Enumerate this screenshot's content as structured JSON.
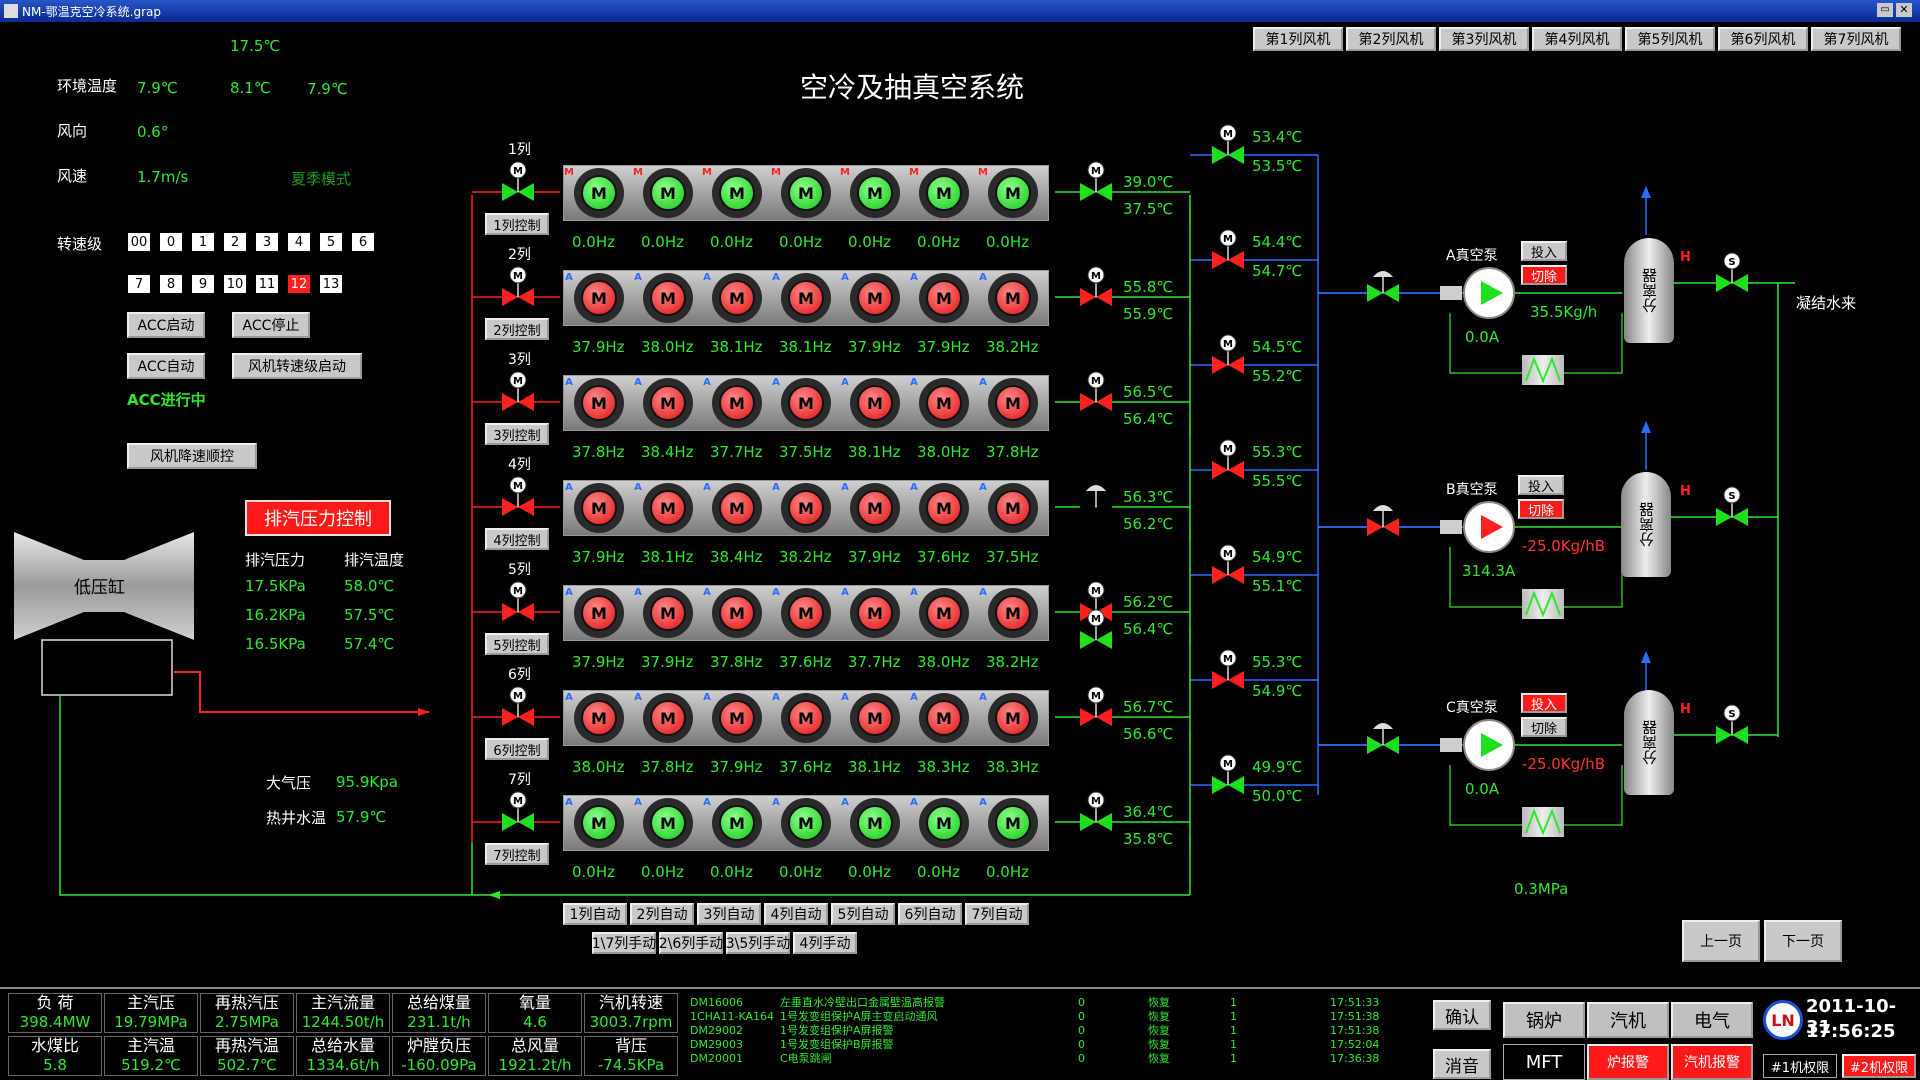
{
  "window": {
    "title": "NM-鄂温克空冷系统.grap"
  },
  "header": {
    "title": "空冷及抽真空系统"
  },
  "fan_tabs": [
    "第1列风机",
    "第2列风机",
    "第3列风机",
    "第4列风机",
    "第5列风机",
    "第6列风机",
    "第7列风机"
  ],
  "env": {
    "top_temp": "17.5℃",
    "env_label": "环境温度",
    "temps": [
      "7.9℃",
      "8.1℃",
      "7.9℃"
    ],
    "wind_dir_label": "风向",
    "wind_dir": "0.6°",
    "wind_speed_label": "风速",
    "wind_speed": "1.7m/s",
    "mode": "夏季模式"
  },
  "speed": {
    "label": "转速级",
    "levels_row1": [
      "00",
      "0",
      "1",
      "2",
      "3",
      "4",
      "5",
      "6"
    ],
    "levels_row2": [
      "7",
      "8",
      "9",
      "10",
      "11",
      "12",
      "13"
    ]
  },
  "acc": {
    "start": "ACC启动",
    "stop": "ACC停止",
    "auto": "ACC自动",
    "fan_speed_start": "风机转速级启动",
    "running": "ACC进行中",
    "fan_down": "风机降速顺控"
  },
  "exhaust": {
    "title": "排汽压力控制",
    "pressure_label": "排汽压力",
    "temp_label": "排汽温度",
    "pressures": [
      "17.5KPa",
      "16.2KPa",
      "16.5KPa"
    ],
    "temps": [
      "58.0℃",
      "57.5℃",
      "57.4℃"
    ]
  },
  "turbine": {
    "label": "低压缸"
  },
  "atmos": {
    "pressure_label": "大气压",
    "pressure": "95.9Kpa",
    "hotwell_label": "热井水温",
    "hotwell": "57.9℃"
  },
  "columns": [
    {
      "label": "1列",
      "ctrl": "1列控制",
      "status": "green",
      "tag": "M",
      "hz": [
        "0.0Hz",
        "0.0Hz",
        "0.0Hz",
        "0.0Hz",
        "0.0Hz",
        "0.0Hz",
        "0.0Hz"
      ],
      "t_in": "39.0℃",
      "t_out": "37.5℃",
      "v_top": "53.4℃",
      "v_bot": "53.5℃"
    },
    {
      "label": "2列",
      "ctrl": "2列控制",
      "status": "red",
      "tag": "A",
      "hz": [
        "37.9Hz",
        "38.0Hz",
        "38.1Hz",
        "38.1Hz",
        "37.9Hz",
        "37.9Hz",
        "38.2Hz"
      ],
      "t_in": "55.8℃",
      "t_out": "55.9℃",
      "v_top": "54.4℃",
      "v_bot": "54.7℃"
    },
    {
      "label": "3列",
      "ctrl": "3列控制",
      "status": "red",
      "tag": "A",
      "hz": [
        "37.8Hz",
        "38.4Hz",
        "37.7Hz",
        "37.5Hz",
        "38.1Hz",
        "38.0Hz",
        "37.8Hz"
      ],
      "t_in": "56.5℃",
      "t_out": "56.4℃",
      "v_top": "54.5℃",
      "v_bot": "55.2℃"
    },
    {
      "label": "4列",
      "ctrl": "4列控制",
      "status": "red",
      "tag": "A",
      "hz": [
        "37.9Hz",
        "38.1Hz",
        "38.4Hz",
        "38.2Hz",
        "37.9Hz",
        "37.6Hz",
        "37.5Hz"
      ],
      "t_in": "56.3℃",
      "t_out": "56.2℃",
      "v_top": "55.3℃",
      "v_bot": "55.5℃"
    },
    {
      "label": "5列",
      "ctrl": "5列控制",
      "status": "red",
      "tag": "A",
      "hz": [
        "37.9Hz",
        "37.9Hz",
        "37.8Hz",
        "37.6Hz",
        "37.7Hz",
        "38.0Hz",
        "38.2Hz"
      ],
      "t_in": "56.2℃",
      "t_out": "56.4℃",
      "v_top": "54.9℃",
      "v_bot": "55.1℃"
    },
    {
      "label": "6列",
      "ctrl": "6列控制",
      "status": "red",
      "tag": "A",
      "hz": [
        "38.0Hz",
        "37.8Hz",
        "37.9Hz",
        "37.6Hz",
        "38.1Hz",
        "38.3Hz",
        "38.3Hz"
      ],
      "t_in": "56.7℃",
      "t_out": "56.6℃",
      "v_top": "55.3℃",
      "v_bot": "54.9℃"
    },
    {
      "label": "7列",
      "ctrl": "7列控制",
      "status": "green",
      "tag": "A",
      "hz": [
        "0.0Hz",
        "0.0Hz",
        "0.0Hz",
        "0.0Hz",
        "0.0Hz",
        "0.0Hz",
        "0.0Hz"
      ],
      "t_in": "36.4℃",
      "t_out": "35.8℃",
      "v_top": "49.9℃",
      "v_bot": "50.0℃"
    }
  ],
  "fan_letter": "M",
  "auto_buttons": [
    "1列自动",
    "2列自动",
    "3列自动",
    "4列自动",
    "5列自动",
    "6列自动",
    "7列自动"
  ],
  "manual_buttons": [
    "1\\7列手动",
    "2\\6列手动",
    "3\\5列手动",
    "4列手动"
  ],
  "pumps": [
    {
      "name": "A真空泵",
      "in": "投入",
      "cut": "切除",
      "in_red": false,
      "cut_red": true,
      "current": "0.0A",
      "flow": "35.5Kg/h",
      "running": false
    },
    {
      "name": "B真空泵",
      "in": "投入",
      "cut": "切除",
      "in_red": false,
      "cut_red": true,
      "current": "314.3A",
      "flow": "-25.0Kg/hB",
      "running": true
    },
    {
      "name": "C真空泵",
      "in": "投入",
      "cut": "切除",
      "in_red": true,
      "cut_red": false,
      "current": "0.0A",
      "flow": "-25.0Kg/hB",
      "running": false
    }
  ],
  "separator_label": "分离器",
  "separator_h": "H",
  "condensate": "凝结水来",
  "pump_pressure": "0.3MPa",
  "nav": {
    "prev": "上一页",
    "next": "下一页"
  },
  "bottom": {
    "stats": [
      {
        "label": "负  荷",
        "value": "398.4MW"
      },
      {
        "label": "主汽压",
        "value": "19.79MPa"
      },
      {
        "label": "再热汽压",
        "value": "2.75MPa"
      },
      {
        "label": "主汽流量",
        "value": "1244.50t/h"
      },
      {
        "label": "总给煤量",
        "value": "231.1t/h"
      },
      {
        "label": "氧量",
        "value": "4.6"
      },
      {
        "label": "汽机转速",
        "value": "3003.7rpm"
      },
      {
        "label": "水煤比",
        "value": "5.8"
      },
      {
        "label": "主汽温",
        "value": "519.2℃"
      },
      {
        "label": "再热汽温",
        "value": "502.7℃"
      },
      {
        "label": "总给水量",
        "value": "1334.6t/h"
      },
      {
        "label": "炉膛负压",
        "value": "-160.09Pa"
      },
      {
        "label": "总风量",
        "value": "1921.2t/h"
      },
      {
        "label": "背压",
        "value": "-74.5KPa"
      }
    ],
    "alarms": [
      {
        "code": "DM16006",
        "text": "左垂直水冷壁出口金属壁温高报警",
        "a": "0",
        "state": "恢复",
        "b": "1",
        "time": "17:51:33"
      },
      {
        "code": "1CHA11-KA164",
        "text": "1号发变组保护A屏主变启动通风",
        "a": "0",
        "state": "恢复",
        "b": "1",
        "time": "17:51:38"
      },
      {
        "code": "DM29002",
        "text": "1号发变组保护A屏报警",
        "a": "0",
        "state": "恢复",
        "b": "1",
        "time": "17:51:38"
      },
      {
        "code": "DM29003",
        "text": "1号发变组保护B屏报警",
        "a": "0",
        "state": "恢复",
        "b": "1",
        "time": "17:52:04"
      },
      {
        "code": "DM20001",
        "text": "C电泵跳闸",
        "a": "0",
        "state": "恢复",
        "b": "1",
        "time": "17:36:38"
      }
    ],
    "confirm": "确认",
    "silence": "消音",
    "sys_buttons": [
      "锅炉",
      "汽机",
      "电气",
      "MFT",
      "炉报警",
      "汽机报警"
    ],
    "logo": "LN",
    "date": "2011-10-31",
    "time": "17:56:25",
    "unit_buttons": [
      "#1机权限",
      "#2机权限"
    ]
  }
}
